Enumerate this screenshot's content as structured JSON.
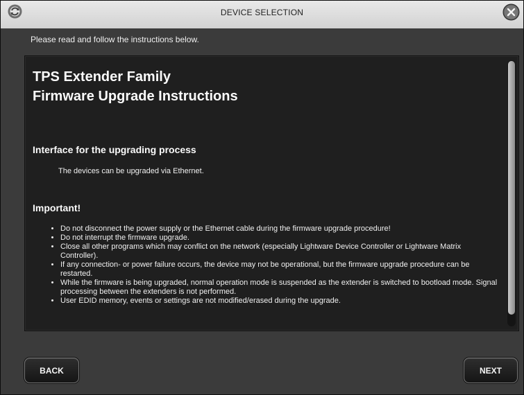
{
  "window": {
    "title": "DEVICE SELECTION",
    "subtitle": "Please read and follow the instructions below."
  },
  "document": {
    "title_line1": "TPS Extender Family",
    "title_line2": "Firmware Upgrade Instructions",
    "section1_heading": "Interface for the upgrading process",
    "section1_text": "The devices can be upgraded via Ethernet.",
    "section2_heading": "Important!",
    "bullets": [
      "Do not disconnect the power supply or the Ethernet cable during the firmware upgrade procedure!",
      "Do not interrupt the firmware upgrade.",
      "Close all other programs which may conflict on the network (especially Lightware Device Controller or Lightware Matrix Controller).",
      "If any connection- or power failure occurs, the device may not be operational, but the firmware upgrade procedure can be restarted.",
      "While the firmware is being upgraded, normal operation mode is suspended as the extender is switched to bootload mode. Signal processing between the extenders is not performed.",
      "User EDID memory, events or settings are not modified/erased during the upgrade."
    ]
  },
  "buttons": {
    "back": "BACK",
    "next": "NEXT"
  },
  "icons": {
    "app": "app-logo-icon",
    "close": "close-icon"
  }
}
